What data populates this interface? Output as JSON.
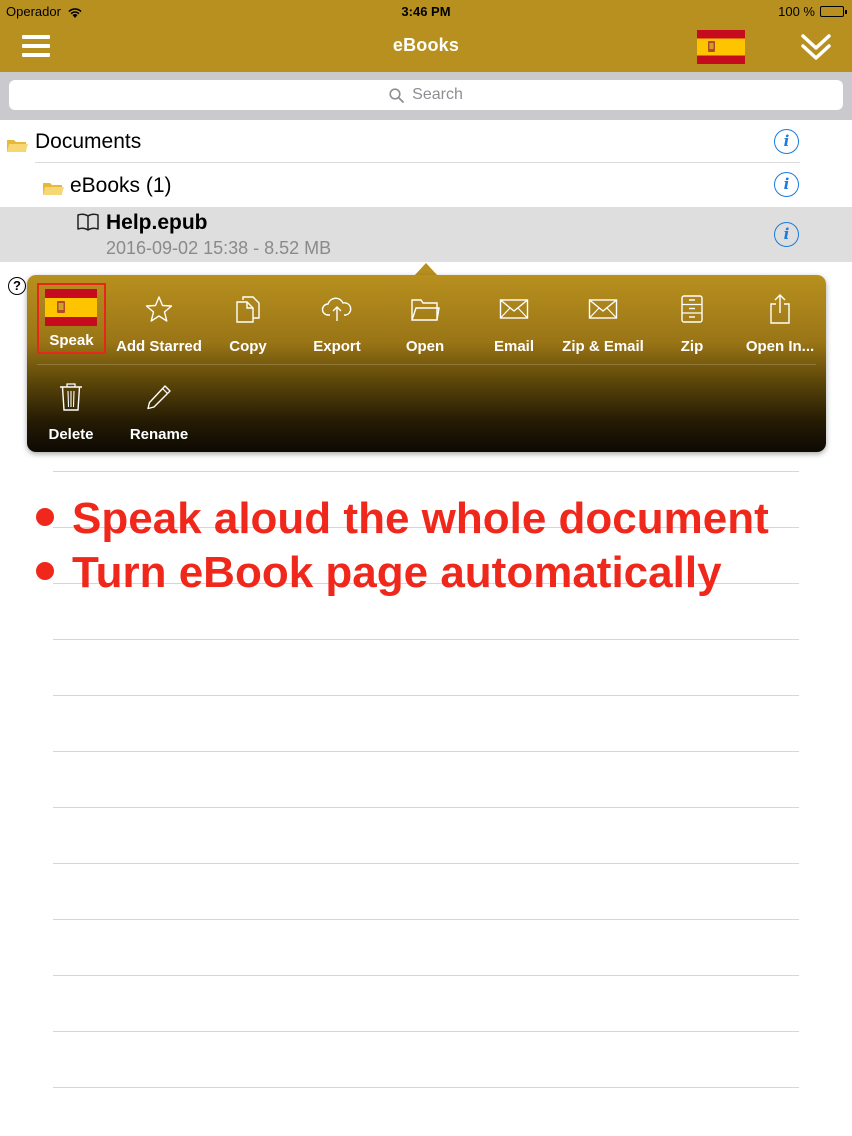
{
  "status_bar": {
    "carrier": "Operador",
    "time": "3:46 PM",
    "battery": "100 %"
  },
  "nav": {
    "title": "eBooks"
  },
  "search": {
    "placeholder": "Search"
  },
  "tree": {
    "documents": "Documents",
    "ebooks_folder": "eBooks (1)",
    "file": {
      "name": "Help.epub",
      "meta": "2016-09-02 15:38 - 8.52 MB"
    }
  },
  "help_mark": "?",
  "actions": {
    "speak": "Speak",
    "add_starred": "Add Starred",
    "copy": "Copy",
    "export": "Export",
    "open": "Open",
    "email": "Email",
    "zip_email": "Zip & Email",
    "zip": "Zip",
    "open_in": "Open In...",
    "delete": "Delete",
    "rename": "Rename"
  },
  "annotations": [
    "Speak aloud the whole document",
    "Turn eBook page automatically"
  ],
  "colors": {
    "accent": "#b8901f",
    "annotation": "#f0281c",
    "info_blue": "#1a7be0"
  }
}
